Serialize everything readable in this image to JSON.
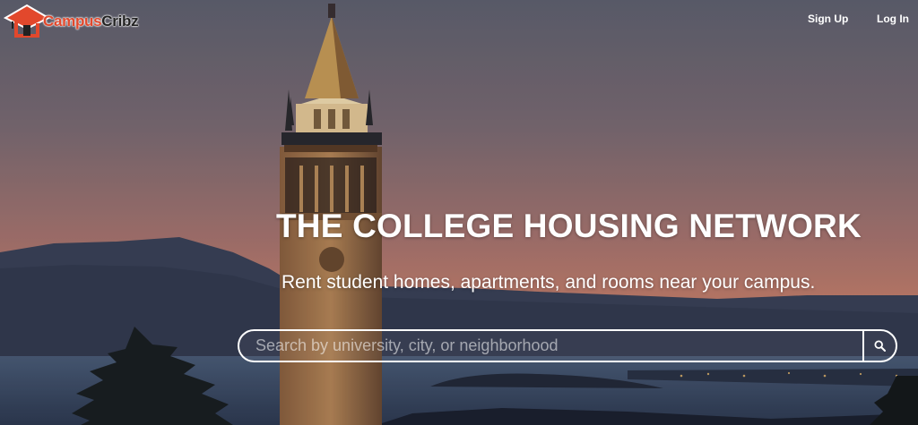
{
  "brand": {
    "name_part1": "Campus",
    "name_part2": "Cribz",
    "accent": "#e2482c"
  },
  "nav": {
    "signup_label": "Sign Up",
    "login_label": "Log In"
  },
  "hero": {
    "headline": "THE COLLEGE HOUSING NETWORK",
    "subline": "Rent student homes, apartments, and rooms near your campus."
  },
  "search": {
    "placeholder": "Search by university, city, or neighborhood",
    "icon": "search-icon"
  }
}
